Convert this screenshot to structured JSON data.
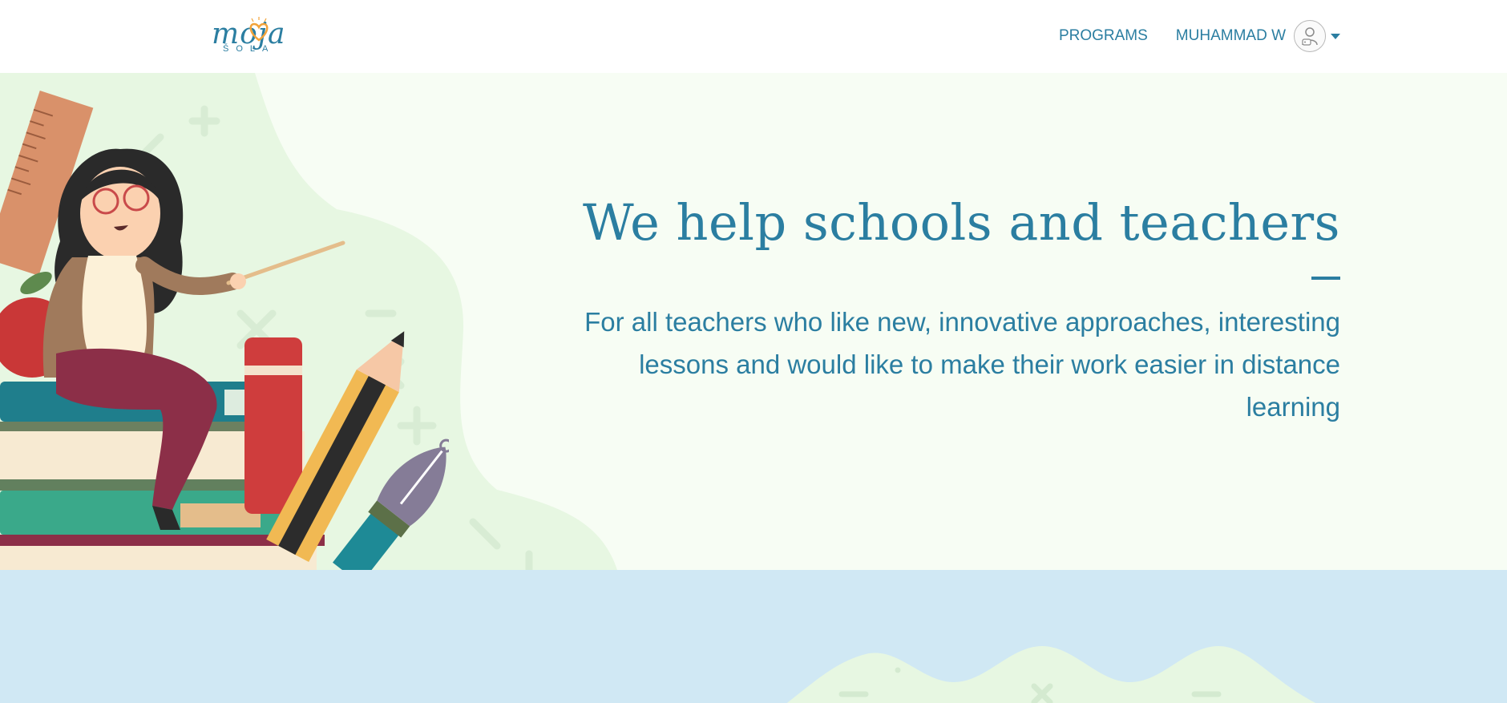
{
  "header": {
    "logo": {
      "script": "moja",
      "sub": "ŠOLA"
    },
    "nav": {
      "programs_label": "PROGRAMS",
      "user_name": "MUHAMMAD W"
    }
  },
  "hero": {
    "title": "We help schools and teachers",
    "subtitle": "For all teachers who like new, innovative approaches, interesting lessons and would like to make their work easier in distance learning"
  },
  "colors": {
    "brand": "#2b7ea1",
    "hero_bg": "#f7fdf4",
    "band_bg": "#d0e8f4",
    "accent_heart": "#f2a33a"
  },
  "icons": {
    "avatar": "user-avatar-icon",
    "caret": "caret-down-icon",
    "heart": "heart-icon"
  }
}
